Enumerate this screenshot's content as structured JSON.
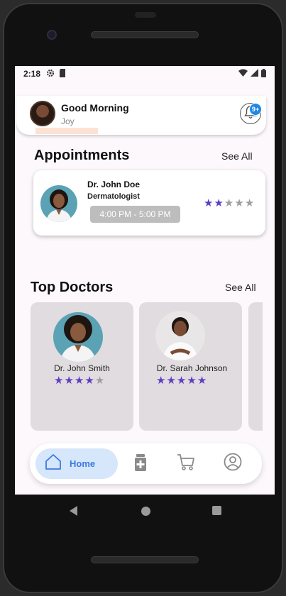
{
  "status": {
    "time": "2:18"
  },
  "header": {
    "greeting": "Good Morning",
    "username": "Joy",
    "notification_badge": "9+"
  },
  "appointments": {
    "title": "Appointments",
    "see_all": "See All",
    "items": [
      {
        "doctor": "Dr. John Doe",
        "specialty": "Dermatologist",
        "time": "4:00 PM - 5:00 PM",
        "rating": 2,
        "max_rating": 5
      }
    ]
  },
  "top_doctors": {
    "title": "Top Doctors",
    "see_all": "See All",
    "items": [
      {
        "name": "Dr. John Smith",
        "rating": 4,
        "max_rating": 5
      },
      {
        "name": "Dr. Sarah Johnson",
        "rating": 5,
        "max_rating": 5
      }
    ]
  },
  "nav": {
    "home_label": "Home",
    "items": [
      "home-icon",
      "medicine-icon",
      "cart-icon",
      "profile-icon"
    ]
  },
  "colors": {
    "accent": "#3b7be0",
    "star": "#5f3dc4",
    "badge": "#1e88e5"
  }
}
